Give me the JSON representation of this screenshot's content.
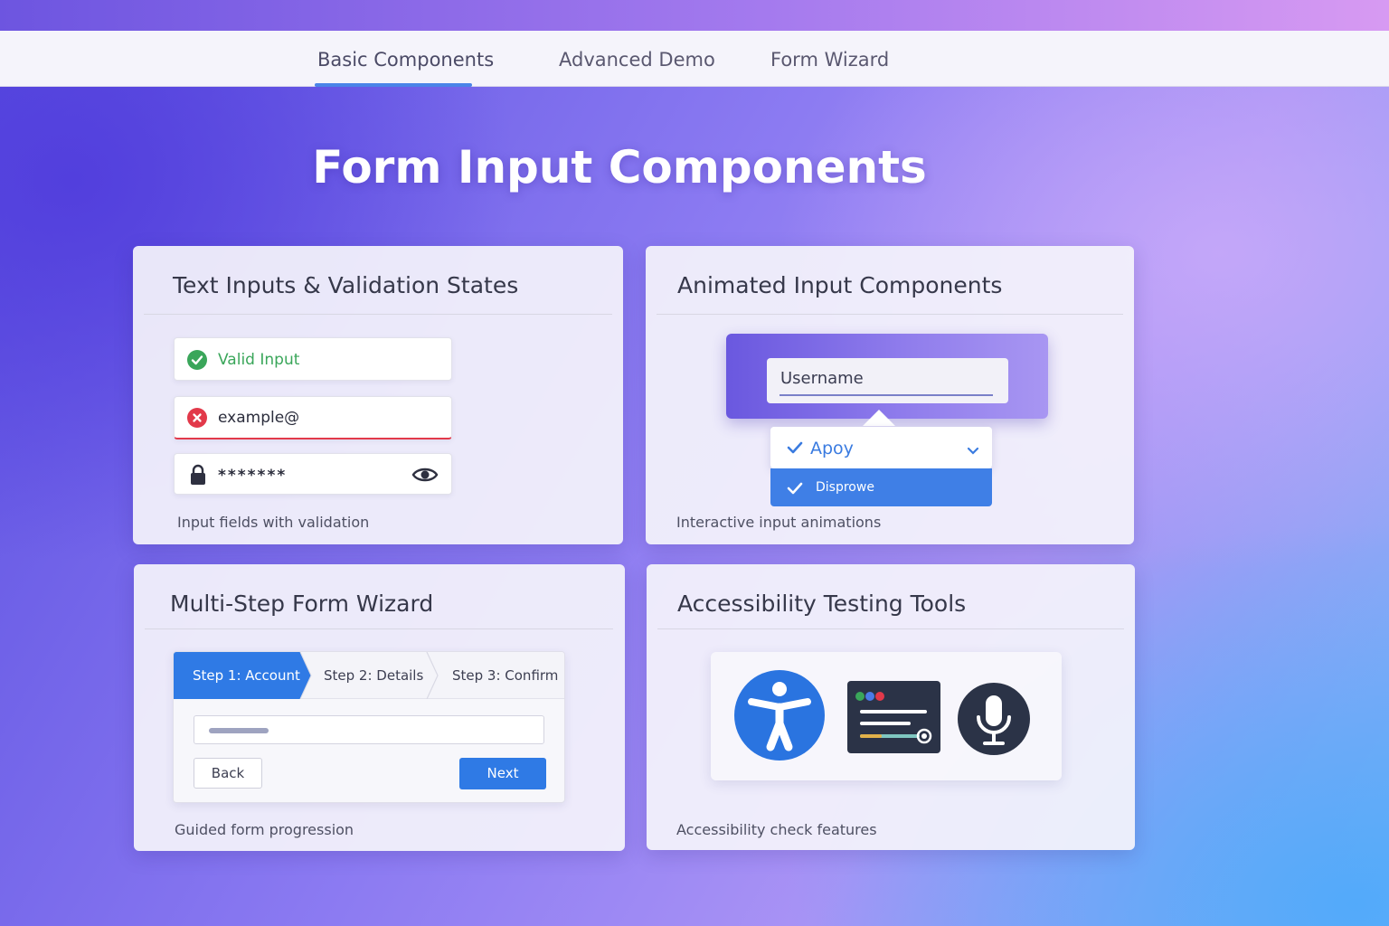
{
  "nav": {
    "tabs": [
      {
        "label": "Basic Components",
        "active": true
      },
      {
        "label": "Advanced Demo",
        "active": false
      },
      {
        "label": "Form Wizard",
        "active": false
      }
    ]
  },
  "page": {
    "title": "Form Input Components"
  },
  "cards": {
    "text_inputs": {
      "title": "Text Inputs & Validation States",
      "valid_value": "Valid Input",
      "error_value": "example@",
      "password_value": "*******",
      "caption": "Input fields with validation"
    },
    "animated": {
      "title": "Animated Input Components",
      "username_label": "Username",
      "dropdown_value": "Apoy",
      "option_label": "Disprowe",
      "caption": "Interactive input animations"
    },
    "wizard": {
      "title": "Multi-Step Form Wizard",
      "steps": [
        "Step 1: Account",
        "Step 2: Details",
        "Step 3: Confirm"
      ],
      "back_label": "Back",
      "next_label": "Next",
      "caption": "Guided form progression"
    },
    "accessibility": {
      "title": "Accessibility Testing Tools",
      "tools": [
        "accessibility-icon",
        "screen-reader-icon",
        "microphone-icon"
      ],
      "caption": "Accessibility check features"
    }
  },
  "colors": {
    "accent": "#2f7ae5",
    "valid": "#3aa65a",
    "error": "#e2394a",
    "text_dark": "#36384a"
  }
}
